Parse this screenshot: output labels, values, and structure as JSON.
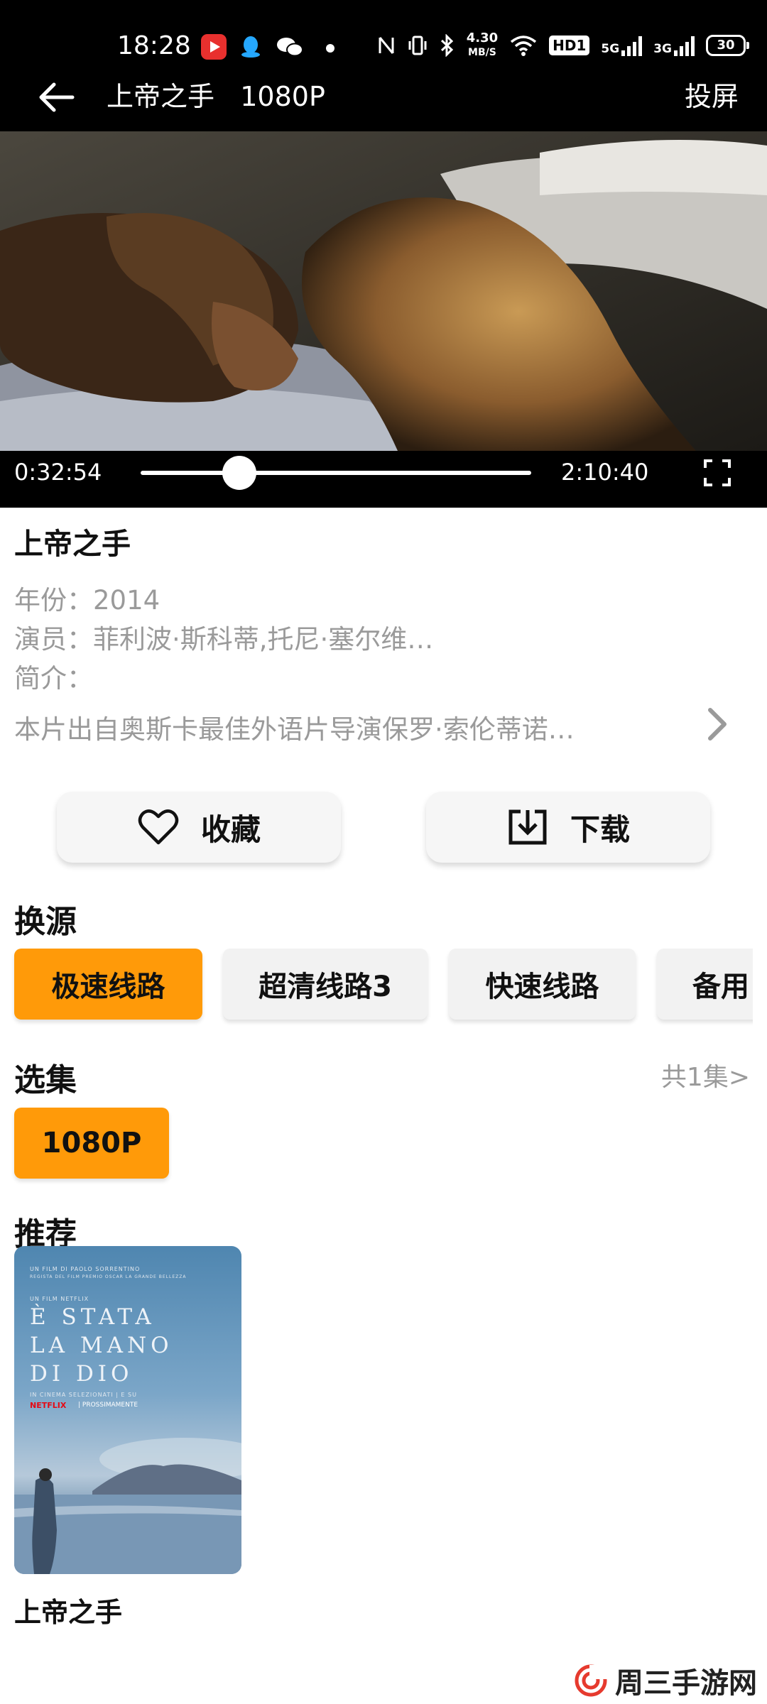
{
  "status_bar": {
    "time": "18:28",
    "net_speed_value": "4.30",
    "net_speed_unit": "MB/S",
    "hd_badge": "HD1",
    "signal_1": "5G",
    "signal_2": "3G",
    "battery": "30"
  },
  "top_bar": {
    "title": "上帝之手   1080P",
    "cast_label": "投屏"
  },
  "player": {
    "current_time": "0:32:54",
    "total_time": "2:10:40",
    "progress": 0.252
  },
  "info": {
    "name": "上帝之手",
    "year_label": "年份：",
    "year": "2014",
    "cast_label": "演员：",
    "cast": "菲利波·斯科蒂,托尼·塞尔维…",
    "synopsis_label": "简介：",
    "synopsis": "本片出自奥斯卡最佳外语片导演保罗·索伦蒂诺…"
  },
  "actions": {
    "favorite": "收藏",
    "download": "下载"
  },
  "sources": {
    "title": "换源",
    "items": [
      "极速线路",
      "超清线路3",
      "快速线路",
      "备用"
    ]
  },
  "episodes": {
    "title": "选集",
    "count": "共1集>",
    "items": [
      "1080P"
    ]
  },
  "recommend": {
    "title": "推荐",
    "items": [
      {
        "name": "上帝之手",
        "poster_small_1": "UN FILM DI PAOLO SORRENTINO",
        "poster_small_2": "REGISTA DEL FILM PREMIO OSCAR LA GRANDE BELLEZZA",
        "poster_small_3": "UN FILM NETFLIX",
        "poster_line_1": "È STATA",
        "poster_line_2": "LA MANO",
        "poster_line_3": "DI DIO",
        "poster_small_4": "IN CINEMA SELEZIONATI | E SU",
        "poster_brand": "NETFLIX",
        "poster_soon": "| PROSSIMAMENTE"
      }
    ]
  },
  "watermark": "周三手游网",
  "colors": {
    "accent": "#ff9a09",
    "chip_idle": "#f2f2f2",
    "muted_text": "#9a9a9a"
  }
}
